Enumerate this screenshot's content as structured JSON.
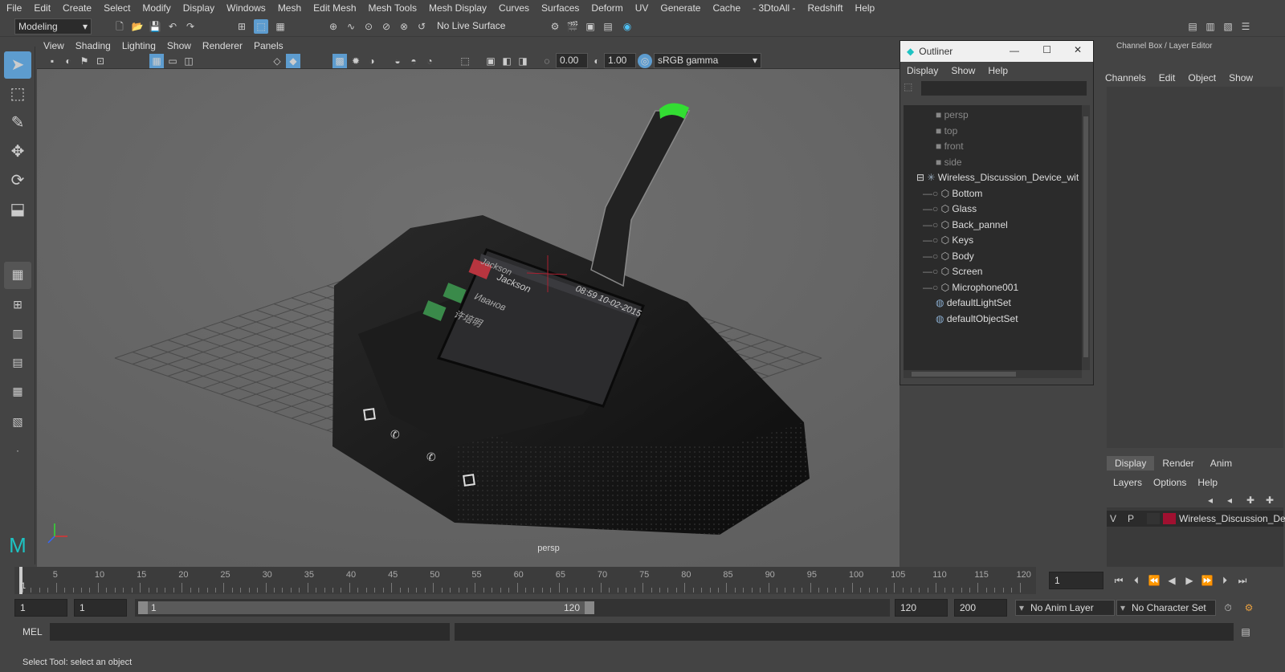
{
  "menu": [
    "File",
    "Edit",
    "Create",
    "Select",
    "Modify",
    "Display",
    "Windows",
    "Mesh",
    "Edit Mesh",
    "Mesh Tools",
    "Mesh Display",
    "Curves",
    "Surfaces",
    "Deform",
    "UV",
    "Generate",
    "Cache",
    "- 3DtoAll -",
    "Redshift",
    "Help"
  ],
  "shelf": {
    "mode": "Modeling",
    "live_surface": "No Live Surface"
  },
  "viewport": {
    "menu": [
      "View",
      "Shading",
      "Lighting",
      "Show",
      "Renderer",
      "Panels"
    ],
    "exposure": "0.00",
    "gamma": "1.00",
    "colorspace": "sRGB gamma",
    "camera_label": "persp",
    "screen": {
      "header": "Jackson",
      "clock": "08:59 10-02-2015",
      "names": [
        "Jackson",
        "Иванов",
        "许培明"
      ]
    }
  },
  "outliner": {
    "title": "Outliner",
    "menu": [
      "Display",
      "Show",
      "Help"
    ],
    "cameras": [
      "persp",
      "top",
      "front",
      "side"
    ],
    "group": "Wireless_Discussion_Device_wit",
    "children": [
      "Bottom",
      "Glass",
      "Back_pannel",
      "Keys",
      "Body",
      "Screen",
      "Microphone001"
    ],
    "sets": [
      "defaultLightSet",
      "defaultObjectSet"
    ]
  },
  "channel_box": {
    "title": "Channel Box / Layer Editor",
    "menu": [
      "Channels",
      "Edit",
      "Object",
      "Show"
    ],
    "tabs": [
      "Display",
      "Render",
      "Anim"
    ],
    "layer_menu": [
      "Layers",
      "Options",
      "Help"
    ],
    "layer": {
      "v": "V",
      "p": "P",
      "name": "Wireless_Discussion_Dev",
      "color": "#a01030"
    }
  },
  "timeline": {
    "ticks": [
      "5",
      "10",
      "15",
      "20",
      "25",
      "30",
      "35",
      "40",
      "45",
      "50",
      "55",
      "60",
      "65",
      "70",
      "75",
      "80",
      "85",
      "90",
      "95",
      "100",
      "105",
      "110",
      "115",
      "120"
    ],
    "current_frame": "1",
    "start_marker": "1"
  },
  "range": {
    "start": "1",
    "playback_start": "1",
    "slider_start": "1",
    "slider_end": "120",
    "playback_end": "120",
    "end": "200",
    "anim_layer": "No Anim Layer",
    "character_set": "No Character Set"
  },
  "mel": {
    "label": "MEL"
  },
  "status": {
    "text": "Select Tool: select an object"
  },
  "colors": {
    "bg": "#444444",
    "viewport": "#6b6b6b",
    "device": "#141414",
    "accent": "#5d9ccf",
    "mic_led": "#33dd33"
  }
}
